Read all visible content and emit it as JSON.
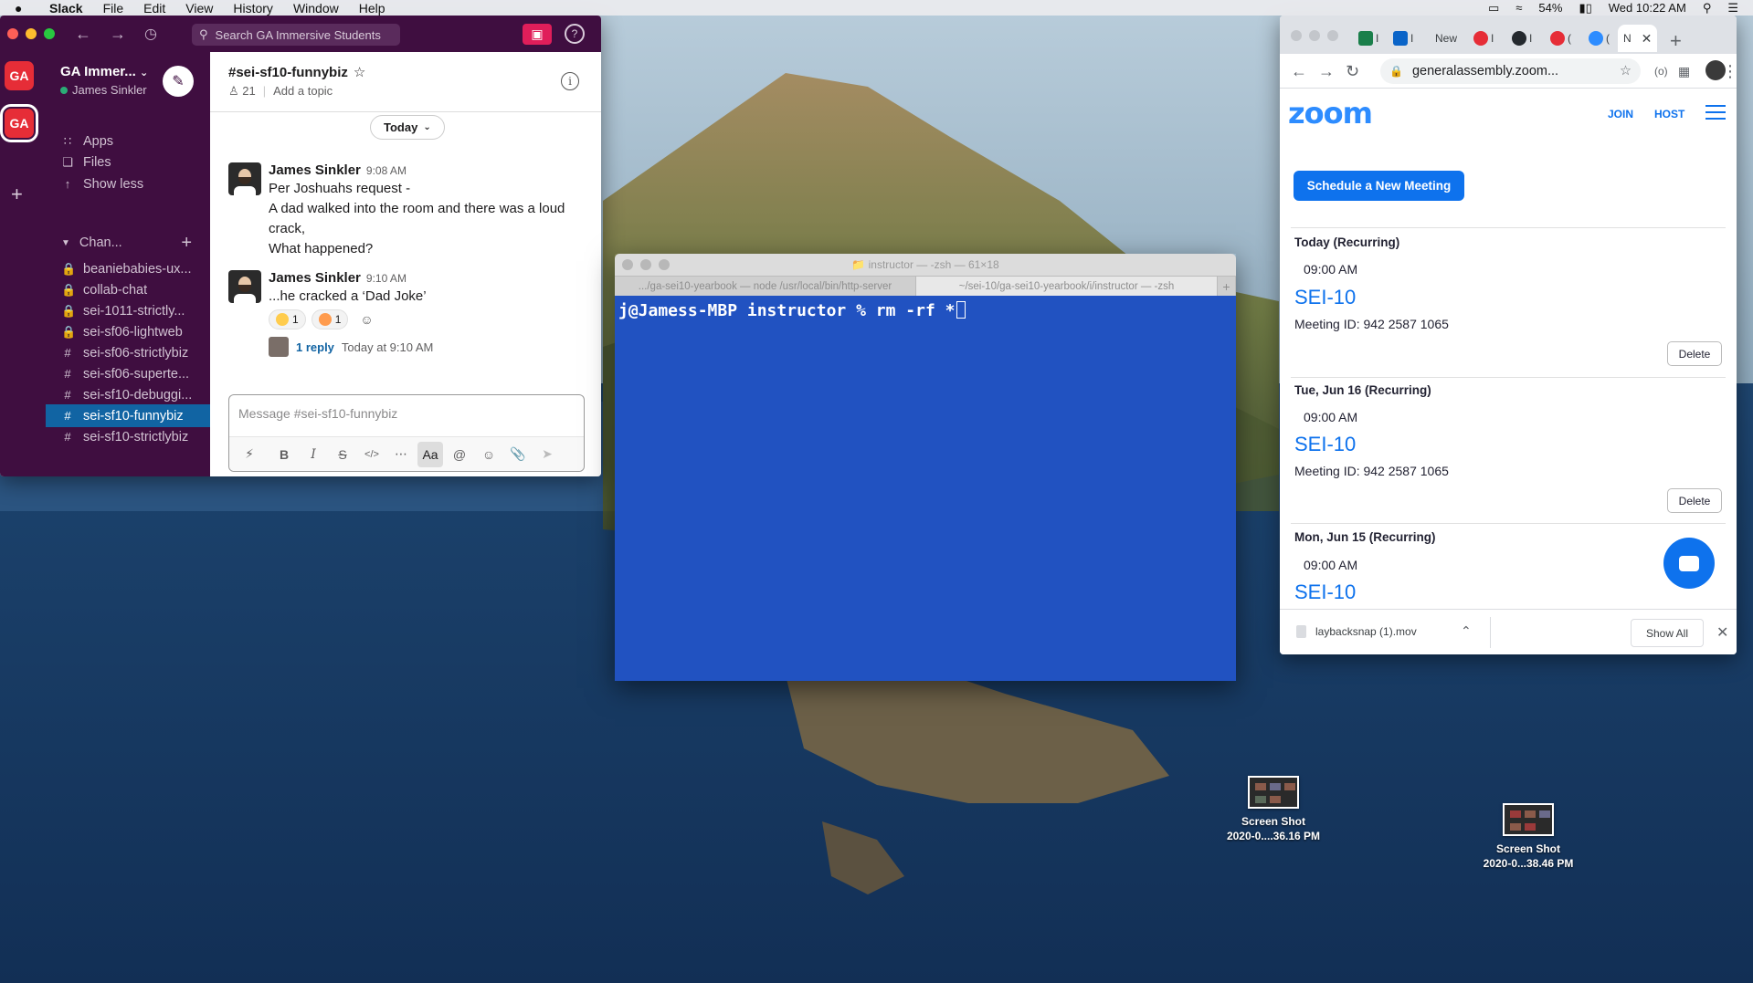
{
  "menubar": {
    "app": "Slack",
    "items": [
      "File",
      "Edit",
      "View",
      "History",
      "Window",
      "Help"
    ],
    "battery": "54%",
    "clock": "Wed 10:22 AM"
  },
  "slack": {
    "search_placeholder": "Search GA Immersive Students",
    "workspace_name": "GA Immer...",
    "user_name": "James Sinkler",
    "ws_icon_1": "GA",
    "ws_icon_2": "GA",
    "nav": [
      {
        "label": "Apps",
        "icon": "grid-icon"
      },
      {
        "label": "Files",
        "icon": "files-icon"
      },
      {
        "label": "Show less",
        "icon": "arrow-up-icon"
      }
    ],
    "channels_header": "Chan...",
    "channels": [
      {
        "name": "beaniebabies-ux...",
        "private": true
      },
      {
        "name": "collab-chat",
        "private": true
      },
      {
        "name": "sei-1011-strictly...",
        "private": true
      },
      {
        "name": "sei-sf06-lightweb",
        "private": true
      },
      {
        "name": "sei-sf06-strictlybiz",
        "private": false
      },
      {
        "name": "sei-sf06-superte...",
        "private": false
      },
      {
        "name": "sei-sf10-debuggi...",
        "private": false
      },
      {
        "name": "sei-sf10-funnybiz",
        "private": false,
        "selected": true
      },
      {
        "name": "sei-sf10-strictlybiz",
        "private": false
      }
    ],
    "channel": {
      "title": "#sei-sf10-funnybiz",
      "members": "21",
      "topic": "Add a topic",
      "day_divider": "Today"
    },
    "messages": [
      {
        "author": "James Sinkler",
        "time": "9:08 AM",
        "lines": [
          "Per Joshuahs request -",
          "A dad walked into the room and there was a loud",
          "crack,",
          "What happened?"
        ]
      },
      {
        "author": "James Sinkler",
        "time": "9:10 AM",
        "lines": [
          "...he cracked a ‘Dad Joke’"
        ],
        "reactions": [
          {
            "count": "1"
          },
          {
            "count": "1"
          }
        ],
        "thread_replies": "1 reply",
        "thread_time": "Today at 9:10 AM"
      }
    ],
    "composer_placeholder": "Message #sei-sf10-funnybiz",
    "composer_format_label": "Aa"
  },
  "terminal": {
    "title": "instructor — -zsh — 61×18",
    "tabs": [
      ".../ga-sei10-yearbook — node /usr/local/bin/http-server",
      "~/sei-10/ga-sei10-yearbook/i/instructor — -zsh"
    ],
    "prompt_line": "j@Jamess-MBP instructor % rm -rf *",
    "colors": {
      "background": "#2152c1",
      "text": "#ffffff"
    }
  },
  "chrome": {
    "tabs": [
      {
        "label": "I",
        "favicon_color": "#1a7f4b"
      },
      {
        "label": "I",
        "favicon_color": "#0a64c8"
      },
      {
        "label": "New",
        "favicon_color": null
      },
      {
        "label": "I",
        "favicon_color": "#e62d37"
      },
      {
        "label": "I",
        "favicon_color": "#24292e"
      },
      {
        "label": "(",
        "favicon_color": "#e62d37"
      },
      {
        "label": "(",
        "favicon_color": "#2d8cff"
      },
      {
        "label": "N",
        "favicon_color": null,
        "active": true
      }
    ],
    "url": "generalassembly.zoom...",
    "download_file": "laybacksnap (1).mov",
    "show_all": "Show All"
  },
  "zoom": {
    "logo": "zoom",
    "join": "JOIN",
    "host": "HOST",
    "schedule_button": "Schedule a New Meeting",
    "meetings": [
      {
        "date": "Today (Recurring)",
        "time": "09:00 AM",
        "topic": "SEI-10",
        "meeting_id": "Meeting ID:  942 2587 1065",
        "delete": "Delete"
      },
      {
        "date": "Tue, Jun 16 (Recurring)",
        "time": "09:00 AM",
        "topic": "SEI-10",
        "meeting_id": "Meeting ID:  942 2587 1065",
        "delete": "Delete"
      },
      {
        "date": "Mon, Jun 15 (Recurring)",
        "time": "09:00 AM",
        "topic": "SEI-10"
      }
    ],
    "accent": "#0e72ed"
  },
  "desktop": {
    "icons": [
      {
        "line1": "Screen Shot",
        "line2": "2020-0....36.16 PM"
      },
      {
        "line1": "Screen Shot",
        "line2": "2020-0...38.46 PM"
      }
    ]
  }
}
